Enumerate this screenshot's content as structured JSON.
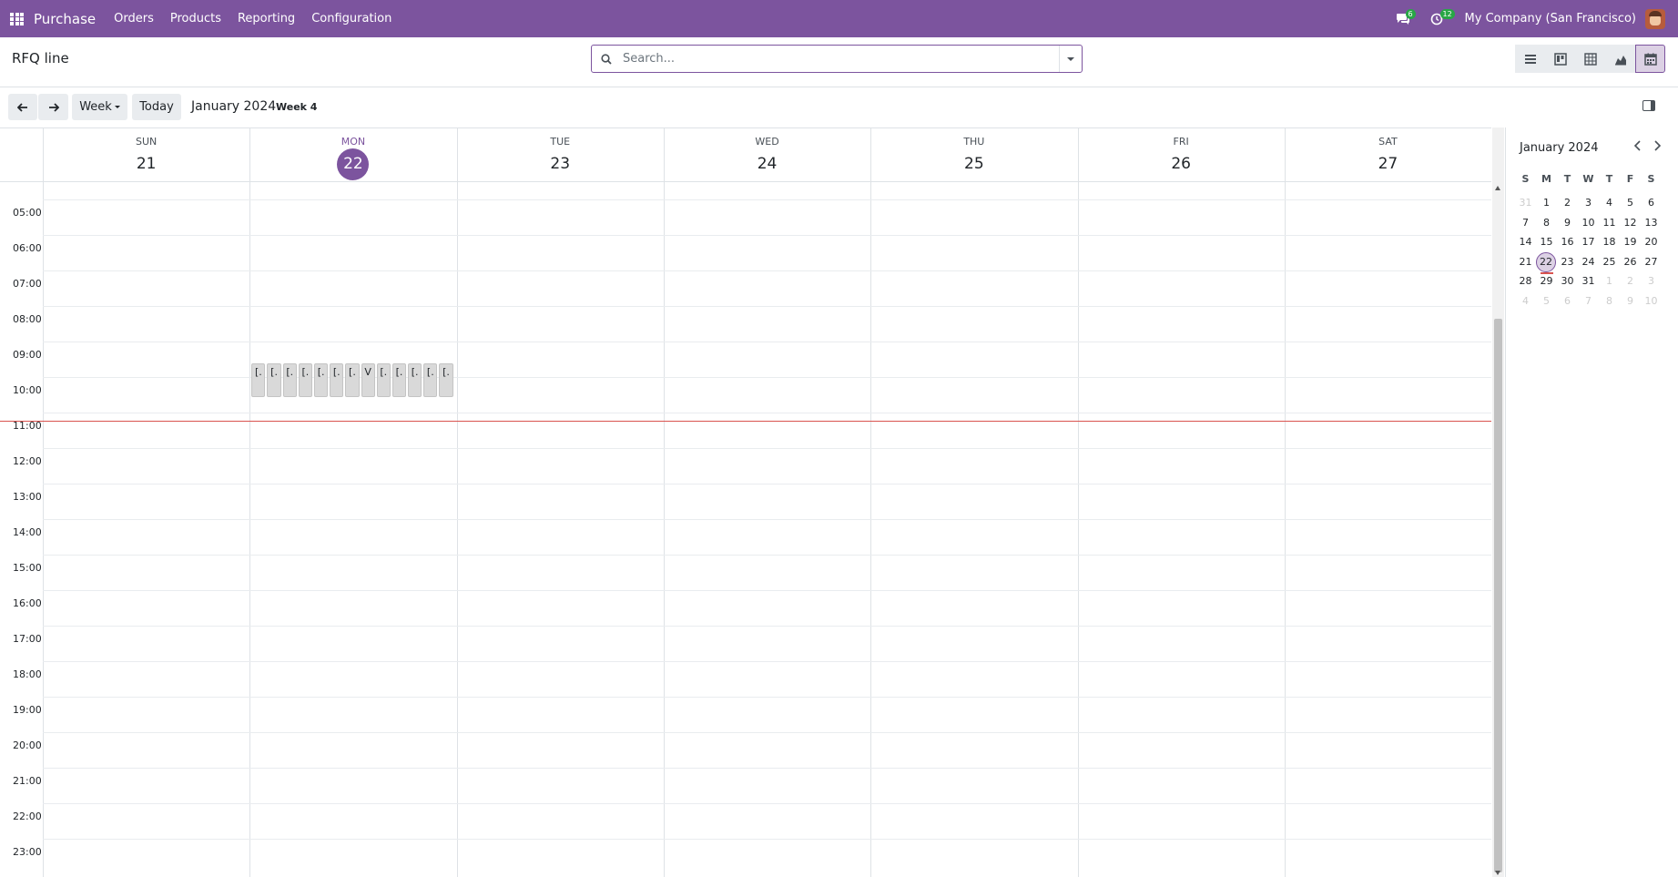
{
  "navbar": {
    "brand": "Purchase",
    "menu": [
      "Orders",
      "Products",
      "Reporting",
      "Configuration"
    ],
    "messages_count": "6",
    "activities_count": "12",
    "company": "My Company (San Francisco)"
  },
  "control_panel": {
    "title": "RFQ line",
    "search_placeholder": "Search...",
    "views": [
      "list-icon",
      "kanban-icon",
      "pivot-icon",
      "graph-icon",
      "calendar-icon"
    ],
    "active_view": "calendar-icon"
  },
  "toolbar": {
    "scale_label": "Week",
    "today_label": "Today",
    "period": "January 2024",
    "week": "Week 4"
  },
  "week": {
    "days": [
      {
        "dow": "SUN",
        "dom": "21"
      },
      {
        "dow": "MON",
        "dom": "22",
        "today": true
      },
      {
        "dow": "TUE",
        "dom": "23"
      },
      {
        "dow": "WED",
        "dom": "24"
      },
      {
        "dow": "THU",
        "dom": "25"
      },
      {
        "dow": "FRI",
        "dom": "26"
      },
      {
        "dow": "SAT",
        "dom": "27"
      }
    ],
    "hours": [
      "05:00",
      "06:00",
      "07:00",
      "08:00",
      "09:00",
      "10:00",
      "11:00",
      "12:00",
      "13:00",
      "14:00",
      "15:00",
      "16:00",
      "17:00",
      "18:00",
      "19:00",
      "20:00",
      "21:00",
      "22:00",
      "23:00"
    ],
    "events": [
      "[.",
      "[.",
      "[.",
      "[.",
      "[.",
      "[.",
      "[.",
      "V",
      "[.",
      "[.",
      "[.",
      "[.",
      "[."
    ],
    "event_day": "MON",
    "event_time": "09:30–10:30",
    "now_time": "11:07"
  },
  "mini_calendar": {
    "title": "January 2024",
    "dow": [
      "S",
      "M",
      "T",
      "W",
      "T",
      "F",
      "S"
    ],
    "weeks": [
      [
        "31",
        "1",
        "2",
        "3",
        "4",
        "5",
        "6"
      ],
      [
        "7",
        "8",
        "9",
        "10",
        "11",
        "12",
        "13"
      ],
      [
        "14",
        "15",
        "16",
        "17",
        "18",
        "19",
        "20"
      ],
      [
        "21",
        "22",
        "23",
        "24",
        "25",
        "26",
        "27"
      ],
      [
        "28",
        "29",
        "30",
        "31",
        "1",
        "2",
        "3"
      ],
      [
        "4",
        "5",
        "6",
        "7",
        "8",
        "9",
        "10"
      ]
    ],
    "today": "22",
    "colors": {
      "accent": "#7c549e",
      "today_bg": "#dcd1e4",
      "now_line": "#d9534f"
    }
  }
}
